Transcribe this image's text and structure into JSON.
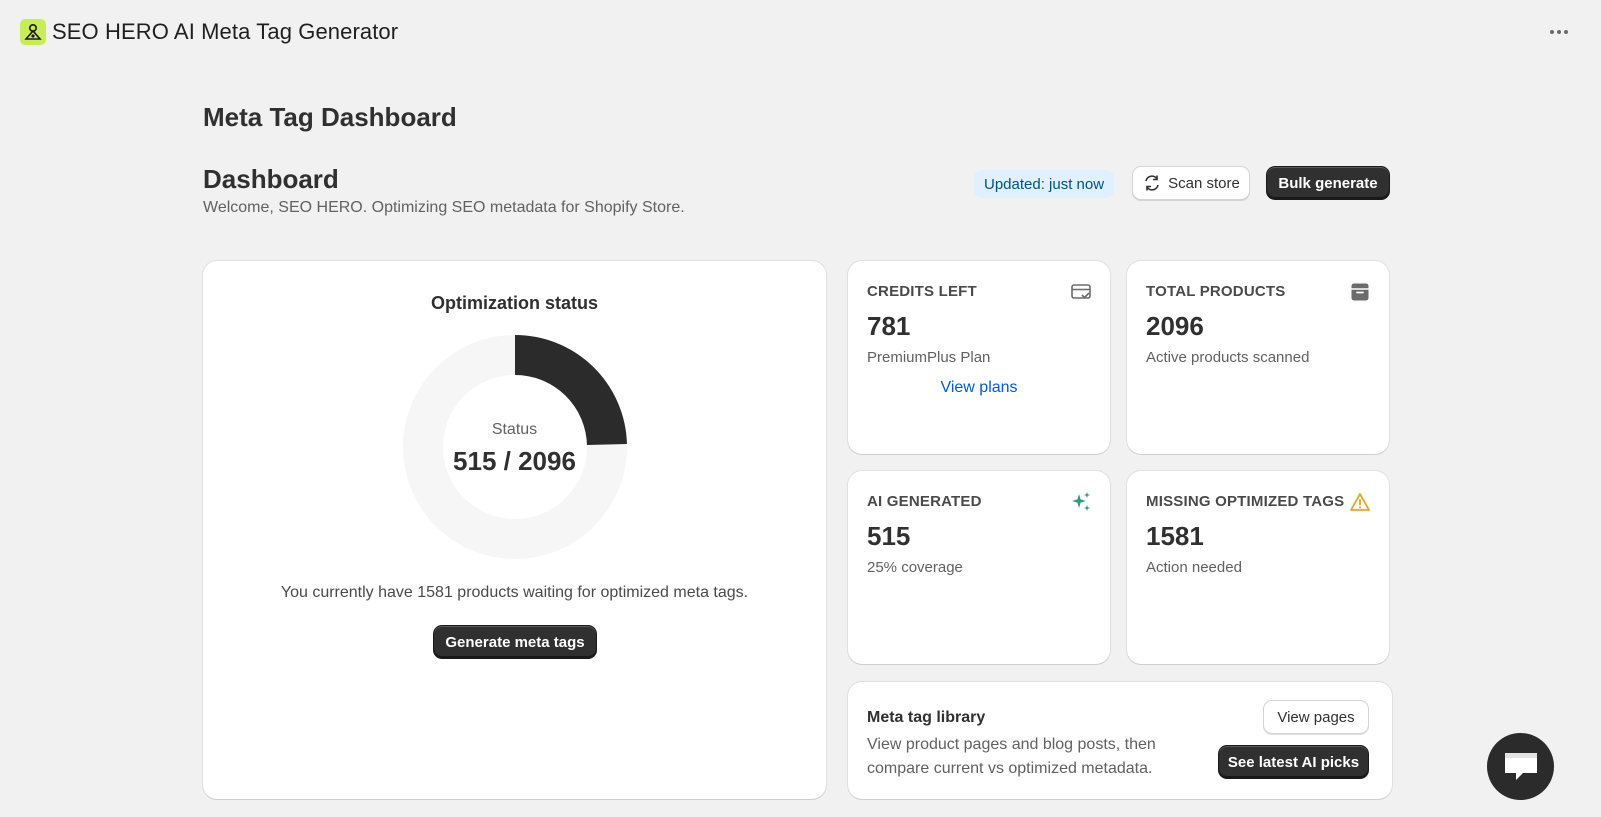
{
  "app": {
    "title": "SEO HERO AI Meta Tag Generator",
    "logo_icon": "robot-logo-icon",
    "more_icon": "more-horizontal-icon"
  },
  "page": {
    "title": "Meta Tag Dashboard",
    "section_title": "Dashboard",
    "subtitle": "Welcome, SEO HERO. Optimizing SEO metadata for Shopify Store."
  },
  "header_actions": {
    "updated_badge": "Updated: just now",
    "scan_label": "Scan store",
    "scan_icon": "refresh-icon",
    "bulk_label": "Bulk generate"
  },
  "status_card": {
    "heading": "Optimization status",
    "donut_label": "Status",
    "donut_value": "515 / 2096",
    "optimized": 515,
    "total": 2096,
    "message": "You currently have 1581 products waiting for optimized meta tags.",
    "button_label": "Generate meta tags",
    "colors": {
      "filled": "#2b2b2b",
      "track": "#f6f6f6"
    }
  },
  "stats": {
    "credits": {
      "label": "CREDITS LEFT",
      "value": "781",
      "sub": "PremiumPlus Plan",
      "link": "View plans",
      "icon": "credit-card-check-icon"
    },
    "total_products": {
      "label": "TOTAL PRODUCTS",
      "value": "2096",
      "sub": "Active products scanned",
      "icon": "archive-box-icon"
    },
    "ai_generated": {
      "label": "AI GENERATED",
      "value": "515",
      "sub": "25% coverage",
      "icon": "sparkles-icon",
      "icon_color": "#2a9d7a"
    },
    "missing": {
      "label": "MISSING OPTIMIZED TAGS",
      "value": "1581",
      "sub": "Action needed",
      "icon": "warning-triangle-icon",
      "icon_color": "#e5a82a"
    }
  },
  "library": {
    "title": "Meta tag library",
    "description": "View product pages and blog posts, then compare current vs optimized metadata.",
    "view_pages_label": "View pages",
    "ai_picks_label": "See latest AI picks"
  },
  "chat": {
    "icon": "chat-bubble-icon"
  }
}
